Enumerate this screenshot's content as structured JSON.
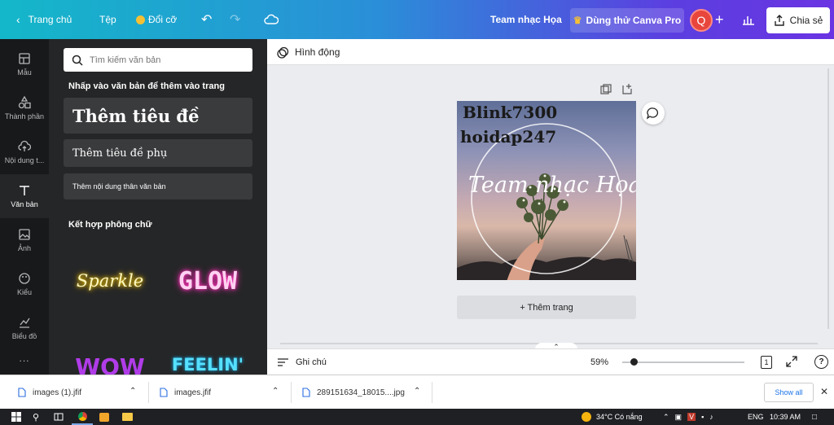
{
  "topbar": {
    "home": "Trang chủ",
    "file": "Tệp",
    "resize": "Đổi cỡ",
    "project_title": "Team nhạc Họa",
    "try_pro": "Dùng thử Canva Pro",
    "avatar_letter": "Q",
    "share": "Chia sẻ"
  },
  "rail": [
    {
      "label": "Mẫu",
      "icon": "template-icon"
    },
    {
      "label": "Thành phần",
      "icon": "elements-icon"
    },
    {
      "label": "Nội dung t...",
      "icon": "upload-icon"
    },
    {
      "label": "Văn bản",
      "icon": "text-icon",
      "active": true
    },
    {
      "label": "Ảnh",
      "icon": "photo-icon"
    },
    {
      "label": "Kiểu",
      "icon": "palette-icon"
    },
    {
      "label": "Biểu đồ",
      "icon": "chart-icon"
    },
    {
      "label": "...",
      "icon": "more-icon"
    }
  ],
  "panel": {
    "search_placeholder": "Tìm kiếm văn bản",
    "hint": "Nhấp vào văn bản để thêm vào trang",
    "heading": "Thêm tiêu đề",
    "subheading": "Thêm tiêu đề phụ",
    "body": "Thêm nội dung thân văn bản",
    "combos_label": "Kết hợp phông chữ",
    "combos": [
      "Sparkle",
      "GLOW",
      "WOW",
      "FEELIN'"
    ]
  },
  "toolstrip": {
    "animate": "Hình động"
  },
  "design": {
    "line1": "Blink7300",
    "line2": "hoidap247",
    "script": "Team nhạc Họa"
  },
  "add_page": "+ Thêm trang",
  "bottombar": {
    "notes": "Ghi chú",
    "zoom": "59%",
    "page_count": "1",
    "zoom_fraction": 0.07
  },
  "downloads": {
    "items": [
      "images (1).jfif",
      "images.jfif",
      "289151634_18015....jpg"
    ],
    "show_all": "Show all"
  },
  "taskbar": {
    "weather": "34°C  Có nắng",
    "lang": "ENG",
    "time": "10:39 AM"
  },
  "colors": {
    "accent": "#8b3dff",
    "rail_bg": "#18191b",
    "panel_bg": "#252627"
  }
}
